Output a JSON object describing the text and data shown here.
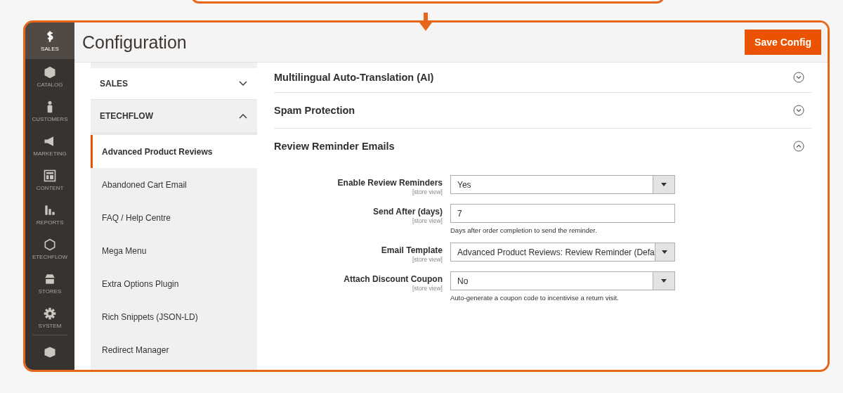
{
  "sidebar": {
    "items": [
      {
        "label": "SALES",
        "selected": true
      },
      {
        "label": "CATALOG",
        "selected": false
      },
      {
        "label": "CUSTOMERS",
        "selected": false
      },
      {
        "label": "MARKETING",
        "selected": false
      },
      {
        "label": "CONTENT",
        "selected": false
      },
      {
        "label": "REPORTS",
        "selected": false
      },
      {
        "label": "ETECHFLOW",
        "selected": false
      },
      {
        "label": "STORES",
        "selected": false
      },
      {
        "label": "SYSTEM",
        "selected": false
      },
      {
        "selected": false
      }
    ]
  },
  "page_title": "Configuration",
  "save_button": "Save Config",
  "config_nav": [
    {
      "title": "SALES",
      "expanded": false
    },
    {
      "title": "ETECHFLOW",
      "expanded": true,
      "items": [
        {
          "label": "Advanced Product Reviews",
          "selected": true
        },
        {
          "label": "Abandoned Cart Email",
          "selected": false
        },
        {
          "label": "FAQ / Help Centre",
          "selected": false
        },
        {
          "label": "Mega Menu",
          "selected": false
        },
        {
          "label": "Extra Options Plugin",
          "selected": false
        },
        {
          "label": "Rich Snippets (JSON-LD)",
          "selected": false
        },
        {
          "label": "Redirect Manager",
          "selected": false
        }
      ]
    }
  ],
  "sections": [
    {
      "title": "Multilingual Auto-Translation (AI)",
      "expanded": false
    },
    {
      "title": "Spam Protection",
      "expanded": false
    },
    {
      "title": "Review Reminder Emails",
      "expanded": true,
      "fields": [
        {
          "kind": "select",
          "label": "Enable Review Reminders",
          "scope": "[store view]",
          "value": "Yes"
        },
        {
          "kind": "text",
          "label": "Send After (days)",
          "scope": "[store view]",
          "value": "7",
          "note": "Days after order completion to send the reminder."
        },
        {
          "kind": "select",
          "label": "Email Template",
          "scope": "[store view]",
          "value": "Advanced Product Reviews: Review Reminder (Defa"
        },
        {
          "kind": "select",
          "label": "Attach Discount Coupon",
          "scope": "[store view]",
          "value": "No",
          "note": "Auto-generate a coupon code to incentivise a return visit."
        }
      ]
    }
  ]
}
